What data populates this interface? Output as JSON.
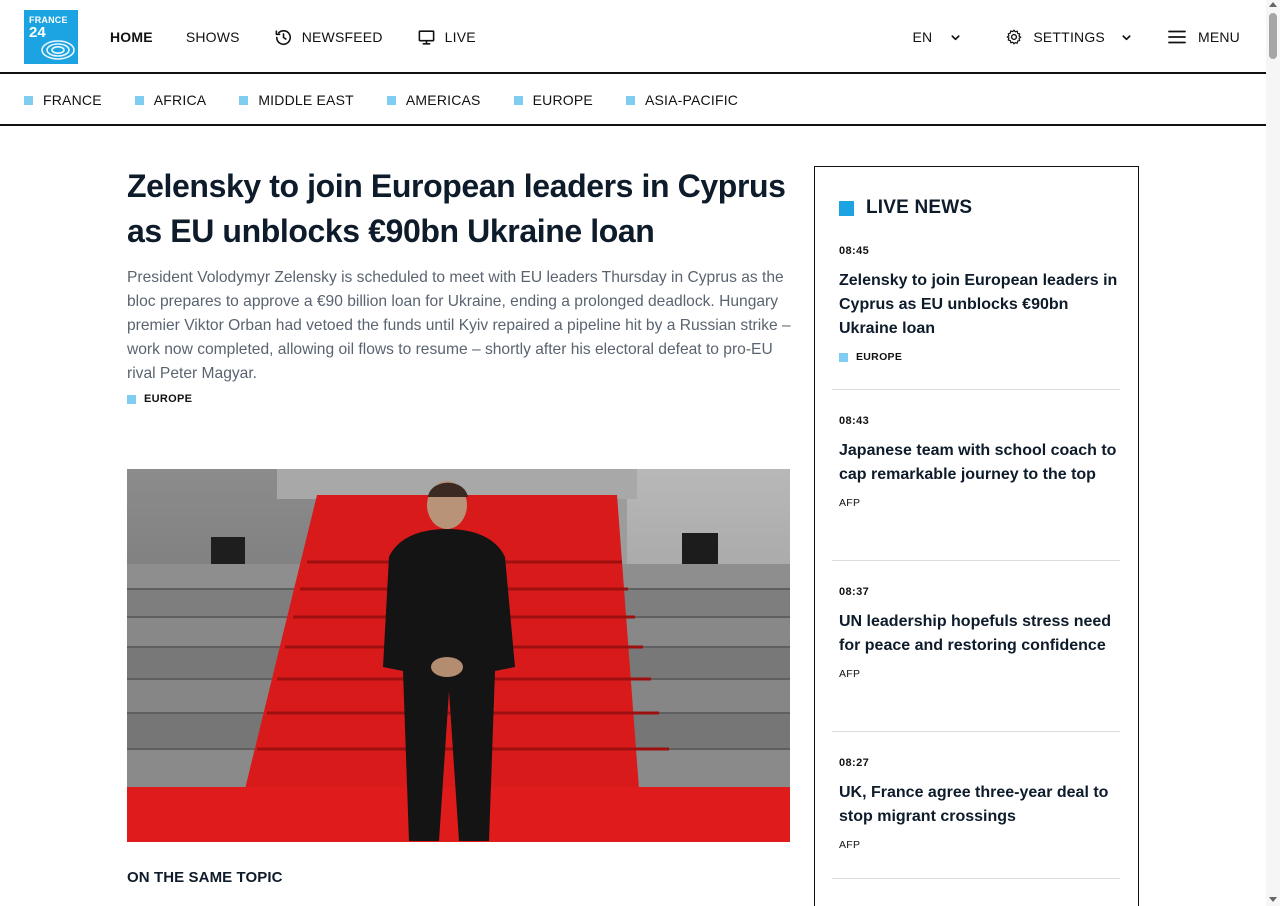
{
  "header": {
    "logo": {
      "line1": "FRANCE",
      "line2": "24",
      "color": "#1ca3e2"
    },
    "nav": [
      {
        "label": "HOME",
        "icon": null
      },
      {
        "label": "SHOWS",
        "icon": null
      },
      {
        "label": "NEWSFEED",
        "icon": "history-clock-icon"
      },
      {
        "label": "LIVE",
        "icon": "monitor-icon"
      }
    ],
    "language": {
      "label": "EN",
      "icon": "chevron-down-icon"
    },
    "settings": {
      "label": "SETTINGS",
      "icon": "gear-icon"
    },
    "menu": {
      "label": "MENU",
      "icon": "hamburger-icon"
    }
  },
  "regions": [
    "FRANCE",
    "AFRICA",
    "MIDDLE EAST",
    "AMERICAS",
    "EUROPE",
    "ASIA-PACIFIC"
  ],
  "article": {
    "headline": "Zelensky to join European leaders in Cyprus as EU unblocks €90bn Ukraine loan",
    "summary": "President Volodymyr Zelensky is scheduled to meet with EU leaders Thursday in Cyprus as the bloc prepares to approve a €90 billion loan for Ukraine, ending a prolonged deadlock. Hungary premier Viktor Orban had vetoed the funds until Kyiv repaired a pipeline hit by a Russian strike – work now completed, allowing oil flows to resume – shortly after his electoral defeat to pro-EU rival Peter Magyar.",
    "tag": "EUROPE",
    "same_topic": "ON THE SAME TOPIC"
  },
  "live_news": {
    "title": "LIVE NEWS",
    "items": [
      {
        "time": "08:45",
        "title": "Zelensky to join European leaders in Cyprus as EU unblocks €90bn Ukraine loan",
        "source": "EUROPE"
      },
      {
        "time": "08:43",
        "title": "Japanese team with school coach to cap remarkable journey to the top",
        "source": "AFP"
      },
      {
        "time": "08:37",
        "title": "UN leadership hopefuls stress need for peace and restoring confidence",
        "source": "AFP"
      },
      {
        "time": "08:27",
        "title": "UK, France agree three-year deal to stop migrant crossings",
        "source": "AFP"
      }
    ]
  },
  "colors": {
    "accent": "#1ca3e2",
    "tag_square": "#7fcdf0",
    "headline": "#0d1b2a",
    "summary": "#5a6470"
  }
}
